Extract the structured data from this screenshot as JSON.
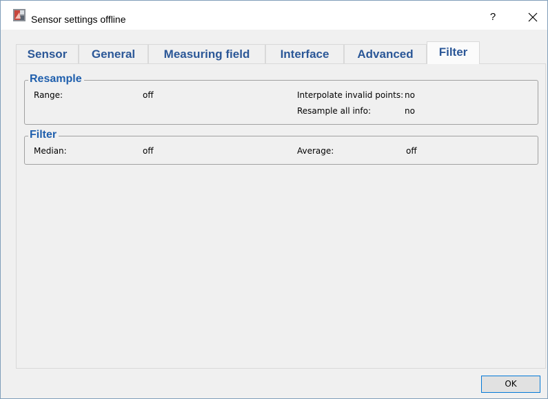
{
  "window": {
    "title": "Sensor settings offline",
    "help_label": "?",
    "icon": "sensor-app-icon",
    "close_icon": "close-icon"
  },
  "tabs": [
    {
      "label": "Sensor",
      "active": false
    },
    {
      "label": "General",
      "active": false
    },
    {
      "label": "Measuring field",
      "active": false
    },
    {
      "label": "Interface",
      "active": false
    },
    {
      "label": "Advanced",
      "active": false
    },
    {
      "label": "Filter",
      "active": true
    }
  ],
  "resample": {
    "title": "Resample",
    "range_label": "Range:",
    "range_value": "off",
    "interpolate_label": "Interpolate invalid points:",
    "interpolate_value": "no",
    "resample_all_label": "Resample all info:",
    "resample_all_value": "no"
  },
  "filter": {
    "title": "Filter",
    "median_label": "Median:",
    "median_value": "off",
    "average_label": "Average:",
    "average_value": "off"
  },
  "footer": {
    "ok_label": "OK"
  },
  "colors": {
    "tab_text": "#2b5797",
    "group_title": "#1f5fad",
    "button_border": "#0078d7"
  }
}
